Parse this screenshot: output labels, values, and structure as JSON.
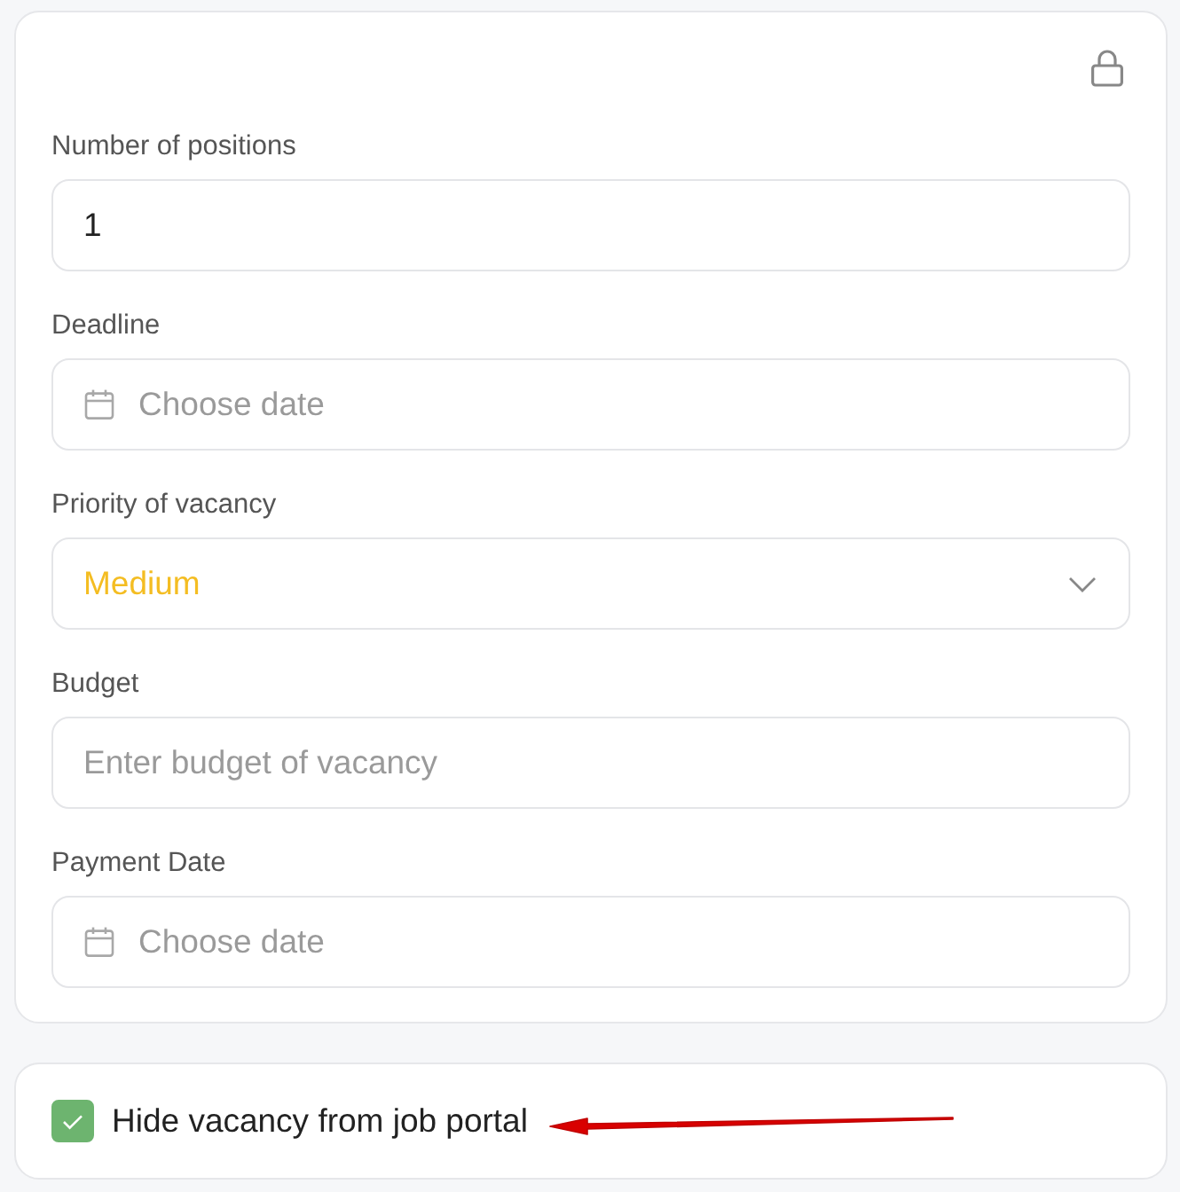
{
  "fields": [
    {
      "kind": "number",
      "label": "Number of positions",
      "value": "1"
    },
    {
      "kind": "date",
      "label": "Deadline",
      "placeholder": "Choose date"
    },
    {
      "kind": "select",
      "label": "Priority of vacancy",
      "value": "Medium",
      "color": "#f4bd22"
    },
    {
      "kind": "text",
      "label": "Budget",
      "placeholder": "Enter budget of vacancy"
    },
    {
      "kind": "date",
      "label": "Payment Date",
      "placeholder": "Choose date"
    }
  ],
  "hide_vacancy": {
    "label": "Hide vacancy from job portal",
    "checked": true
  }
}
